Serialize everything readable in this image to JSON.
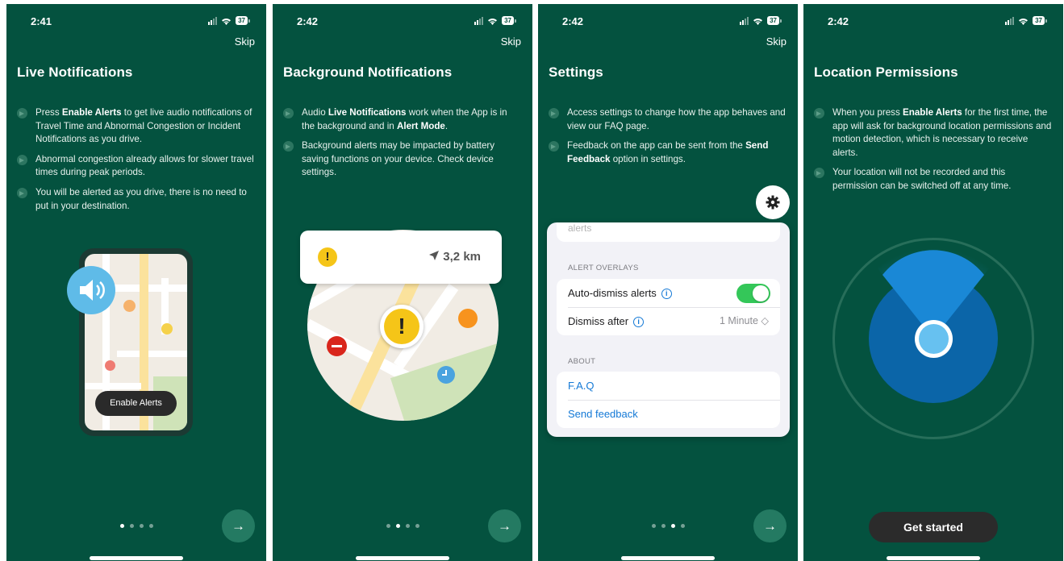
{
  "screens": [
    {
      "time": "2:41",
      "battery": "37",
      "skip": "Skip",
      "title": "Live Notifications",
      "bullets": [
        {
          "pre": "Press ",
          "bold": "Enable Alerts",
          "post": " to get live audio notifications of Travel Time and Abnormal Congestion or Incident Notifications as you drive.",
          "bold2": "",
          "post2": ""
        },
        {
          "pre": "Abnormal congestion already allows for slower travel times during peak periods.",
          "bold": "",
          "post": "",
          "bold2": "",
          "post2": ""
        },
        {
          "pre": "You will be alerted as you drive, there is no need to put in your destination.",
          "bold": "",
          "post": "",
          "bold2": "",
          "post2": ""
        }
      ],
      "illustration_button": "Enable Alerts",
      "next_icon": "→"
    },
    {
      "time": "2:42",
      "battery": "37",
      "skip": "Skip",
      "title": "Background Notifications",
      "bullets": [
        {
          "pre": "Audio ",
          "bold": "Live Notifications",
          "post": " work when the App is in the background and in ",
          "bold2": "Alert Mode",
          "post2": "."
        },
        {
          "pre": "Background alerts may be impacted by battery saving functions on your device. Check device settings.",
          "bold": "",
          "post": "",
          "bold2": "",
          "post2": ""
        }
      ],
      "distance": "3,2 km",
      "next_icon": "→"
    },
    {
      "time": "2:42",
      "battery": "37",
      "skip": "Skip",
      "title": "Settings",
      "bullets": [
        {
          "pre": "Access settings to change how the app behaves and view our FAQ page.",
          "bold": "",
          "post": "",
          "bold2": "",
          "post2": ""
        },
        {
          "pre": "Feedback on the app can be sent from the ",
          "bold": "Send Feedback",
          "post": " option in settings.",
          "bold2": "",
          "post2": ""
        }
      ],
      "settings": {
        "top_item": "alerts",
        "section_overlays": "ALERT OVERLAYS",
        "auto_dismiss": "Auto-dismiss alerts",
        "auto_dismiss_on": true,
        "dismiss_after": "Dismiss after",
        "dismiss_value": "1 Minute ◇",
        "section_about": "ABOUT",
        "faq": "F.A.Q",
        "send_feedback": "Send feedback"
      },
      "next_icon": "→"
    },
    {
      "time": "2:42",
      "battery": "37",
      "title": "Location Permissions",
      "bullets": [
        {
          "pre": "When you press ",
          "bold": "Enable Alerts",
          "post": " for the first time, the app will ask for background location permissions and motion detection, which is necessary to receive alerts.",
          "bold2": "",
          "post2": ""
        },
        {
          "pre": "Your location will not be recorded and this permission can be switched off at any time.",
          "bold": "",
          "post": "",
          "bold2": "",
          "post2": ""
        }
      ],
      "get_started": "Get started"
    }
  ],
  "colors": {
    "background": "#04523f",
    "accent_button": "#247a62",
    "toggle_on": "#34c759",
    "link": "#1479d6"
  }
}
